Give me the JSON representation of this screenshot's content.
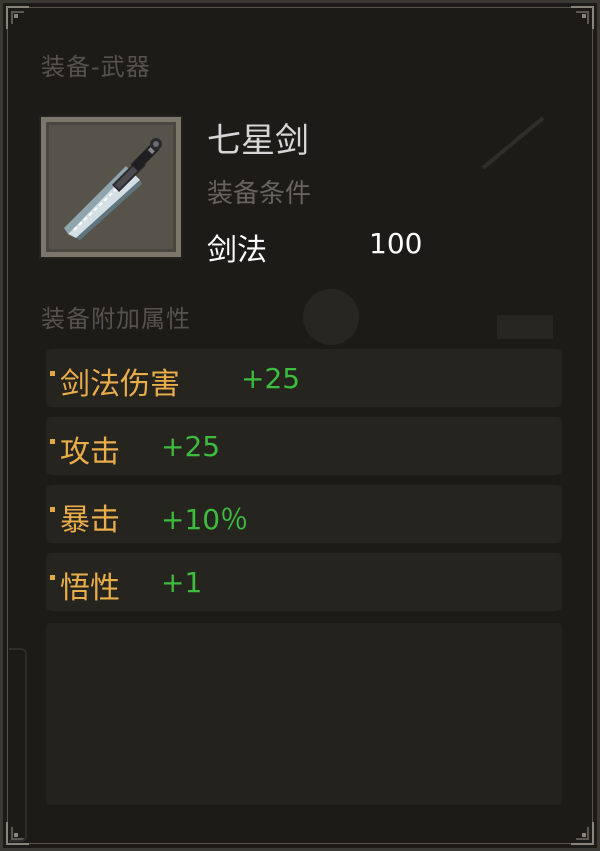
{
  "header": {
    "category": "装备-武器"
  },
  "item": {
    "name": "七星剑",
    "icon": "sword-icon",
    "requirement_title": "装备条件",
    "requirement": {
      "name": "剑法",
      "value": "100"
    }
  },
  "attributes": {
    "title": "装备附加属性",
    "items": [
      {
        "name": "剑法伤害",
        "value": "+25"
      },
      {
        "name": "攻击",
        "value": "+25"
      },
      {
        "name": "暴击",
        "value": "+10％"
      },
      {
        "name": "悟性",
        "value": "+1"
      }
    ]
  },
  "colors": {
    "background": "#1c1b18",
    "attribute_name": "#e9ad4a",
    "attribute_value": "#3dbd3e",
    "muted_text": "#55524b",
    "primary_text": "#ffffff"
  }
}
